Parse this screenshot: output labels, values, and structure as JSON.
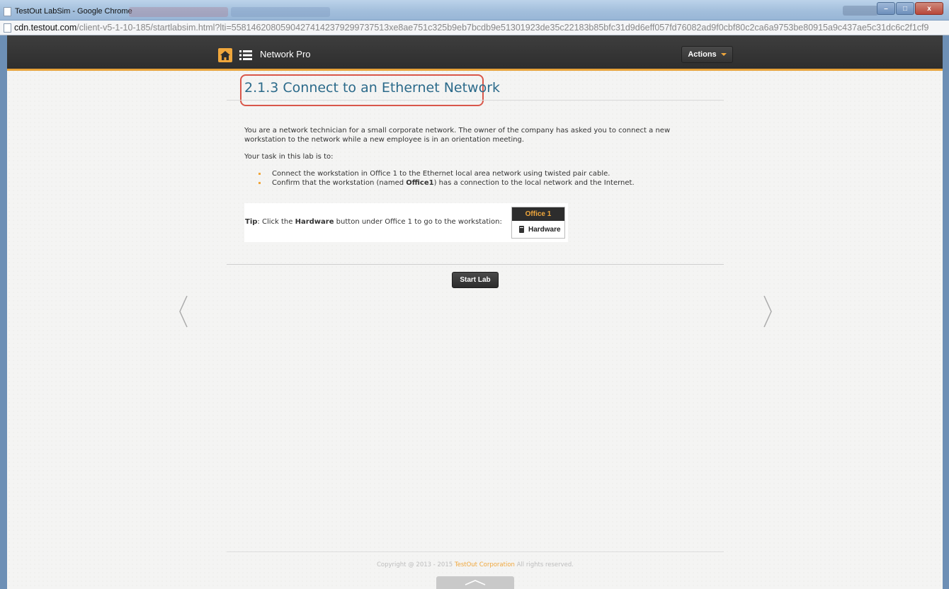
{
  "window": {
    "title": "TestOut LabSim - Google Chrome",
    "controls": {
      "minimize": "–",
      "maximize": "□",
      "close": "x"
    }
  },
  "address_bar": {
    "host": "cdn.testout.com",
    "path": "/client-v5-1-10-185/startlabsim.html?lti=55814620805904274142379299737513xe8ae751c325b9eb7bcdb9e51301923de35c22183b85bfc31d9d6eff057fd76082ad9f0cbf80c2ca6a9753be80915a9c437ae5c31dc6c2f1cf9"
  },
  "navbar": {
    "app_name": "Network Pro",
    "actions_label": "Actions",
    "home_icon": "home-icon",
    "menu_icon": "list-icon",
    "accent_color": "#e8a33a"
  },
  "lab": {
    "title": "2.1.3 Connect to an Ethernet Network",
    "intro": "You are a network technician for a small corporate network. The owner of the company has asked you to connect a new workstation to the network while a new employee is in an orientation meeting.",
    "task_heading": "Your task in this lab is to:",
    "tasks": {
      "t1": "Connect the workstation in Office 1 to the Ethernet local area network using twisted pair cable.",
      "t2_pre": "Confirm that the workstation (named ",
      "t2_bold": "Office1",
      "t2_post": ") has a connection to the local network and the Internet."
    },
    "tip": {
      "label": "Tip",
      "pre": ": Click the ",
      "bold": "Hardware",
      "post": " button under Office 1 to go to the workstation:",
      "widget_title": "Office 1",
      "widget_button": "Hardware"
    },
    "start_button": "Start Lab"
  },
  "footer": {
    "pre": "Copyright @ 2013 - 2015 ",
    "link": "TestOut Corporation",
    "post": " All rights reserved."
  }
}
